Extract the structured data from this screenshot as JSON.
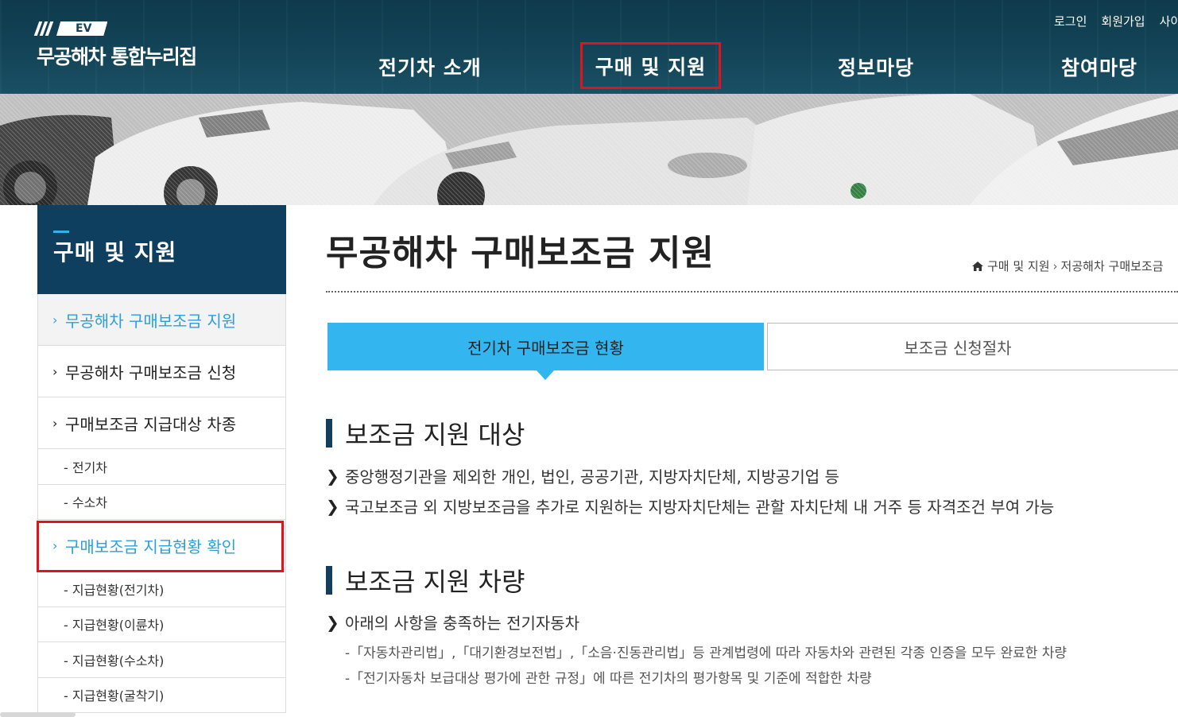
{
  "header": {
    "logo_mark": "EV",
    "logo_text": "무공해차 통합누리집",
    "util_links": [
      "로그인",
      "회원가입",
      "사이트맵"
    ],
    "gnb": [
      "전기차 소개",
      "구매 및 지원",
      "정보마당",
      "참여마당"
    ]
  },
  "sidebar": {
    "title": "구매 및 지원",
    "items": [
      {
        "label": "무공해차 구매보조금 지원"
      },
      {
        "label": "무공해차 구매보조금 신청"
      },
      {
        "label": "구매보조금 지급대상 차종"
      },
      {
        "label": "- 전기차"
      },
      {
        "label": "- 수소차"
      },
      {
        "label": "구매보조금 지급현황 확인"
      },
      {
        "label": "- 지급현황(전기차)"
      },
      {
        "label": "- 지급현황(이륜차)"
      },
      {
        "label": "- 지급현황(수소차)"
      },
      {
        "label": "- 지급현황(굴착기)"
      }
    ]
  },
  "main": {
    "title": "무공해차 구매보조금 지원",
    "breadcrumb": [
      "구매 및 지원",
      "저공해차 구매보조금"
    ],
    "tabs": [
      "전기차 구매보조금 현황",
      "보조금 신청절차"
    ],
    "sections": [
      {
        "title": "보조금 지원 대상",
        "bullets": [
          "중앙행정기관을 제외한 개인, 법인, 공공기관, 지방자치단체, 지방공기업 등",
          "국고보조금 외 지방보조금을 추가로 지원하는 지방자치단체는 관할 자치단체 내 거주 등 자격조건 부여 가능"
        ]
      },
      {
        "title": "보조금 지원 차량",
        "bullets": [
          "아래의 사항을 충족하는 전기자동차"
        ],
        "sub": [
          "-「자동차관리법」,「대기환경보전법」,「소음·진동관리법」등 관계법령에 따라 자동차와 관련된 각종 인증을 모두 완료한 차량",
          "-「전기자동차 보급대상 평가에 관한 규정」에 따른 전기차의 평가항목 및 기준에 적합한 차량"
        ]
      }
    ]
  },
  "colors": {
    "header_bg": "#134457",
    "sidebar_title_bg": "#0e3f5e",
    "accent_blue": "#33b5ef",
    "active_text": "#2d9fd8",
    "highlight_red": "#e1131c"
  }
}
